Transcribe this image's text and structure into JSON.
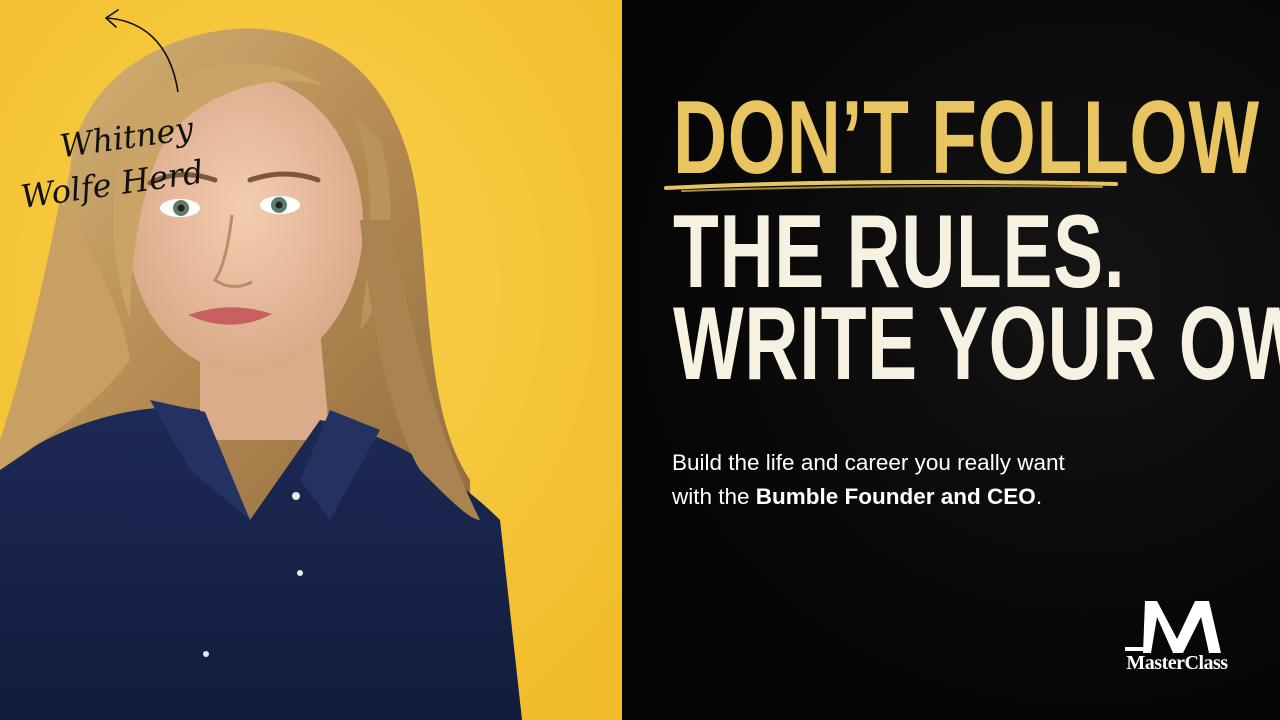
{
  "headline": {
    "line1": "DON’T FOLLOW",
    "line2": "THE RULES.",
    "line3": "WRITE YOUR OWN."
  },
  "subtext": {
    "part1": "Build the life and career you really want",
    "part2": "with the ",
    "bold": "Bumble Founder and CEO",
    "end": "."
  },
  "signature": {
    "line1": "Whitney",
    "line2": "Wolfe Herd"
  },
  "brand": {
    "name": "MasterClass"
  },
  "colors": {
    "accent_gold": "#e9c561",
    "cream": "#f7f1e1",
    "photo_bg": "#f6c73c",
    "panel_bg": "#000000"
  },
  "icons": [
    "arrow-icon",
    "masterclass-logo-icon"
  ]
}
